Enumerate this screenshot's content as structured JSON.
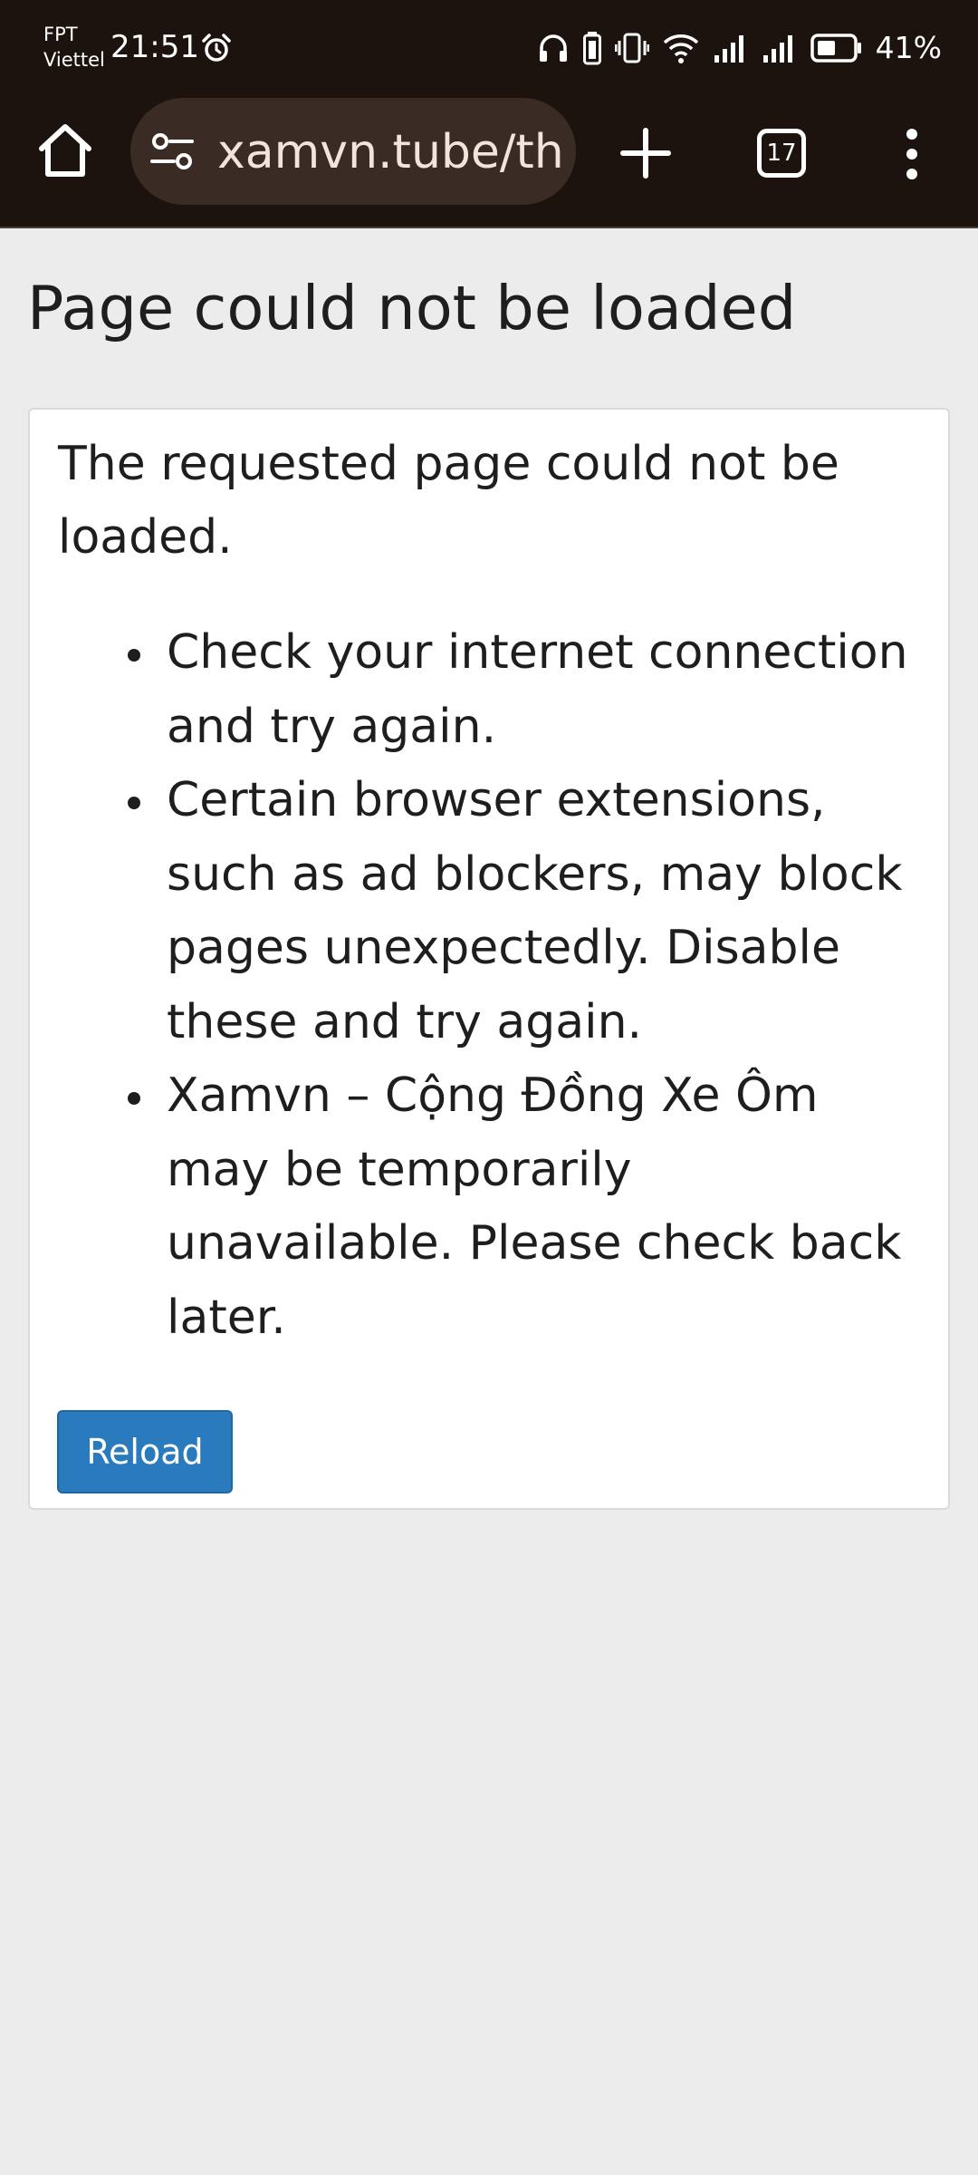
{
  "status_bar": {
    "carrier_line1": "FPT",
    "carrier_line2": "Viettel",
    "time": "21:51",
    "battery_percent": "41%",
    "icons": [
      "alarm-icon",
      "headphones-icon",
      "battery-saver-icon",
      "vibrate-icon",
      "wifi-icon",
      "signal-icon",
      "signal-icon",
      "battery-icon"
    ]
  },
  "toolbar": {
    "url": "xamvn.tube/th",
    "tab_count": "17",
    "icons": [
      "home-icon",
      "site-settings-icon",
      "plus-icon",
      "tab-switcher-icon",
      "more-vert-icon"
    ]
  },
  "page": {
    "title": "Page could not be loaded",
    "message": "The requested page could not be loaded.",
    "tips": [
      "Check your internet connection and try again.",
      "Certain browser extensions, such as ad blockers, may block pages unexpectedly. Disable these and try again.",
      "Xamvn – Cộng Đồng Xe Ôm may be temporarily unavailable. Please check back later."
    ],
    "reload_label": "Reload"
  },
  "colors": {
    "chrome_bg": "#1d130e",
    "url_bar_bg": "#3a2c24",
    "page_bg": "#ececec",
    "card_bg": "#ffffff",
    "button_bg": "#2a7bbd"
  }
}
